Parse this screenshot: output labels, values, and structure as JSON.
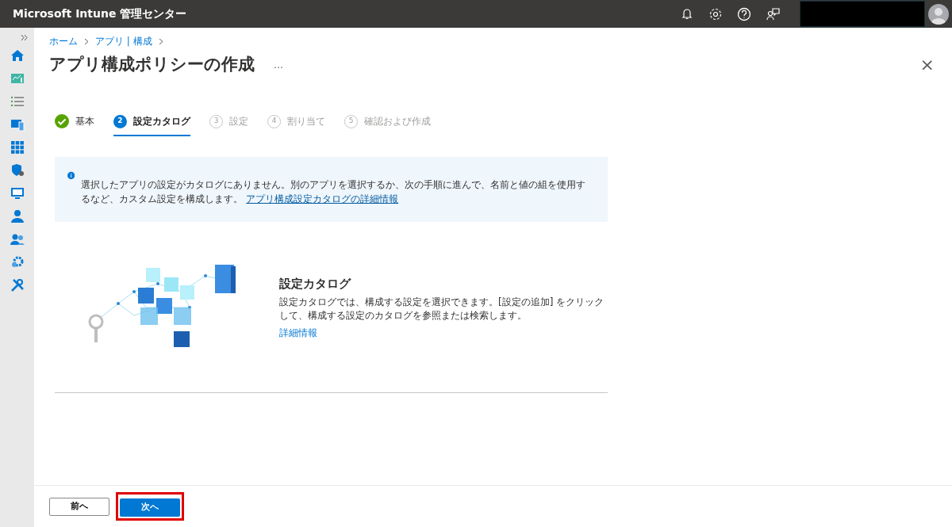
{
  "header": {
    "title": "Microsoft Intune 管理センター"
  },
  "breadcrumb": [
    "ホーム",
    "アプリ | 構成"
  ],
  "page": {
    "title": "アプリ構成ポリシーの作成",
    "more": "…",
    "close": "×"
  },
  "steps": [
    {
      "label": "基本",
      "kind": "done",
      "selected": false
    },
    {
      "number": "2",
      "label": "設定カタログ",
      "kind": "current",
      "selected": true
    },
    {
      "number": "3",
      "label": "設定",
      "kind": "todo",
      "selected": false
    },
    {
      "number": "4",
      "label": "割り当て",
      "kind": "todo",
      "selected": false
    },
    {
      "number": "5",
      "label": "確認および作成",
      "kind": "todo",
      "selected": false
    }
  ],
  "notice": {
    "text": "選択したアプリの設定がカタログにありません。別のアプリを選択するか、次の手順に進んで、名前と値の組を使用するなど、カスタム設定を構成します。",
    "link": "アプリ構成設定カタログの詳細情報"
  },
  "catalog": {
    "title": "設定カタログ",
    "description": "設定カタログでは、構成する設定を選択できます。[設定の追加] をクリックして、構成する設定のカタログを参照または検索します。",
    "link": "詳細情報"
  },
  "footer": {
    "buttons": [
      {
        "label": "前へ",
        "kind": "secondary",
        "highlighted": false
      },
      {
        "label": "次へ",
        "kind": "primary",
        "highlighted": true
      }
    ]
  }
}
